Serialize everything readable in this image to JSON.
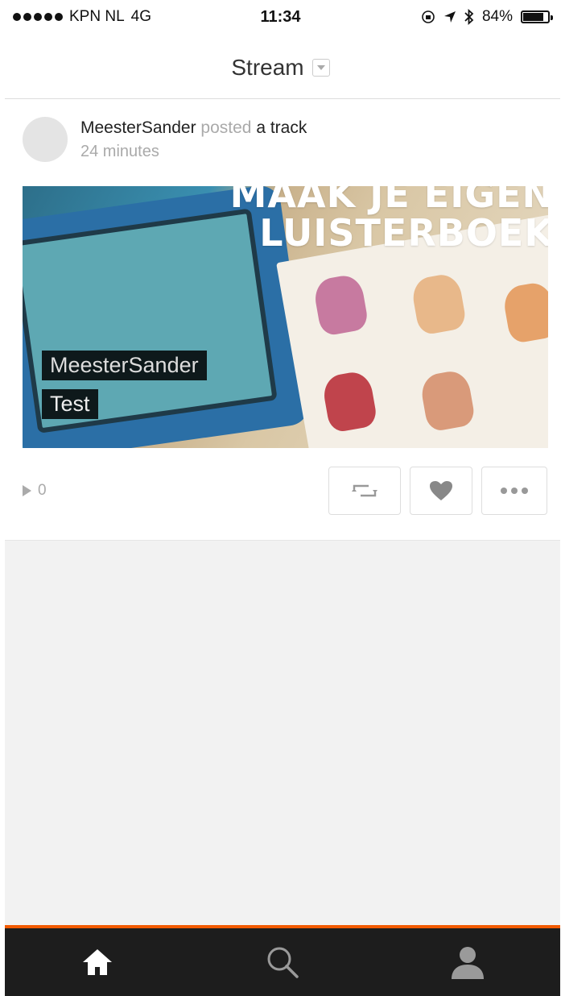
{
  "status_bar": {
    "carrier": "KPN NL",
    "network": "4G",
    "time": "11:34",
    "battery_text": "84%",
    "battery_level": 0.84,
    "signal_bars": 5
  },
  "header": {
    "title": "Stream"
  },
  "post": {
    "username": "MeesterSander",
    "verb": "posted",
    "object": "a track",
    "time_ago": "24 minutes",
    "artwork_headline": "MAAK JE EIGEN\nLUISTERBOEK",
    "overlay_user": "MeesterSander",
    "overlay_track": "Test",
    "play_count": "0"
  },
  "tabs": [
    {
      "name": "home",
      "icon": "home-icon",
      "active": true
    },
    {
      "name": "search",
      "icon": "search-icon",
      "active": false
    },
    {
      "name": "profile",
      "icon": "user-icon",
      "active": false
    }
  ],
  "colors": {
    "accent": "#f25a00",
    "tab_bar": "#1d1d1d",
    "feed_bg": "#f2f2f2"
  }
}
